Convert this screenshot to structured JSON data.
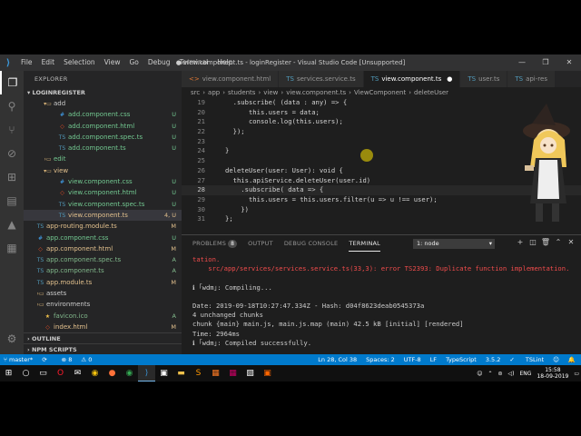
{
  "window": {
    "title": "● view.component.ts - loginRegister - Visual Studio Code [Unsupported]",
    "menu": [
      "File",
      "Edit",
      "Selection",
      "View",
      "Go",
      "Debug",
      "Terminal",
      "Help"
    ],
    "controls": [
      "—",
      "❐",
      "✕"
    ]
  },
  "sidebar": {
    "header": "EXPLORER",
    "project": "LOGINREGISTER",
    "items": [
      {
        "label": "add",
        "status": "",
        "kind": "folder-open",
        "indent": 22,
        "color": "c-plain"
      },
      {
        "label": "add.component.css",
        "status": "U",
        "kind": "css",
        "indent": 38,
        "color": "c-new"
      },
      {
        "label": "add.component.html",
        "status": "U",
        "kind": "html",
        "indent": 38,
        "color": "c-new"
      },
      {
        "label": "add.component.spec.ts",
        "status": "U",
        "kind": "ts",
        "indent": 38,
        "color": "c-new"
      },
      {
        "label": "add.component.ts",
        "status": "U",
        "kind": "ts",
        "indent": 38,
        "color": "c-new"
      },
      {
        "label": "edit",
        "status": "",
        "kind": "folder",
        "indent": 22,
        "color": "c-new"
      },
      {
        "label": "view",
        "status": "",
        "kind": "folder-open",
        "indent": 22,
        "color": "c-mod"
      },
      {
        "label": "view.component.css",
        "status": "U",
        "kind": "css",
        "indent": 38,
        "color": "c-new"
      },
      {
        "label": "view.component.html",
        "status": "U",
        "kind": "html",
        "indent": 38,
        "color": "c-new"
      },
      {
        "label": "view.component.spec.ts",
        "status": "U",
        "kind": "ts",
        "indent": 38,
        "color": "c-new"
      },
      {
        "label": "view.component.ts",
        "status": "4, U",
        "kind": "ts",
        "indent": 38,
        "color": "c-mod"
      },
      {
        "label": "app-routing.module.ts",
        "status": "M",
        "kind": "ts",
        "indent": 14,
        "color": "c-mod"
      },
      {
        "label": "app.component.css",
        "status": "U",
        "kind": "css",
        "indent": 14,
        "color": "c-new"
      },
      {
        "label": "app.component.html",
        "status": "M",
        "kind": "html",
        "indent": 14,
        "color": "c-mod"
      },
      {
        "label": "app.component.spec.ts",
        "status": "A",
        "kind": "ts",
        "indent": 14,
        "color": "c-added"
      },
      {
        "label": "app.component.ts",
        "status": "A",
        "kind": "ts",
        "indent": 14,
        "color": "c-added"
      },
      {
        "label": "app.module.ts",
        "status": "M",
        "kind": "ts",
        "indent": 14,
        "color": "c-mod"
      },
      {
        "label": "assets",
        "status": "",
        "kind": "folder",
        "indent": 14,
        "color": "c-plain"
      },
      {
        "label": "environments",
        "status": "",
        "kind": "folder",
        "indent": 14,
        "color": "c-plain"
      },
      {
        "label": "favicon.ico",
        "status": "A",
        "kind": "ico",
        "indent": 22,
        "color": "c-added"
      },
      {
        "label": "index.html",
        "status": "M",
        "kind": "html",
        "indent": 22,
        "color": "c-mod"
      }
    ],
    "outline": "OUTLINE",
    "npm": "NPM SCRIPTS"
  },
  "tabs": [
    {
      "label": "view.component.html",
      "icon": "<>",
      "active": false
    },
    {
      "label": "services.service.ts",
      "icon": "TS",
      "active": false
    },
    {
      "label": "view.component.ts",
      "icon": "TS",
      "active": true,
      "close": "●"
    },
    {
      "label": "user.ts",
      "icon": "TS",
      "active": false
    },
    {
      "label": "api-res",
      "icon": "TS",
      "active": false
    }
  ],
  "breadcrumb": [
    "src",
    "app",
    "students",
    "view",
    "view.component.ts",
    "ViewComponent",
    "deleteUser"
  ],
  "code": {
    "lines": [
      {
        "n": "19",
        "html": "  .subscribe( (data : any) => {"
      },
      {
        "n": "20",
        "html": "      this.users = data;"
      },
      {
        "n": "21",
        "html": "      console.log(this.users);"
      },
      {
        "n": "22",
        "html": "  });"
      },
      {
        "n": "23",
        "html": ""
      },
      {
        "n": "24",
        "html": "}"
      },
      {
        "n": "25",
        "html": ""
      },
      {
        "n": "26",
        "html": "deleteUser(user: User): void {"
      },
      {
        "n": "27",
        "html": "  this.apiService.deleteUser(user.id)"
      },
      {
        "n": "28",
        "html": "    .subscribe( data => {"
      },
      {
        "n": "29",
        "html": "      this.users = this.users.filter(u => u !== user);"
      },
      {
        "n": "30",
        "html": "    })"
      },
      {
        "n": "31",
        "html": "};"
      }
    ]
  },
  "panel": {
    "tabs": [
      "PROBLEMS",
      "OUTPUT",
      "DEBUG CONSOLE",
      "TERMINAL"
    ],
    "problems_count": "8",
    "terminal_select": "1: node",
    "terminal": [
      {
        "text": "tation.",
        "cls": "err"
      },
      {
        "text": "    src/app/services/services.service.ts(33,3): error TS2393: Duplicate function implementation.",
        "cls": "err"
      },
      {
        "text": "",
        "cls": ""
      },
      {
        "text": "ℹ ｢wdm｣: Compiling...",
        "cls": ""
      },
      {
        "text": "",
        "cls": ""
      },
      {
        "text": "Date: 2019-09-18T10:27:47.334Z - Hash: d04f8623deab0545373a",
        "cls": ""
      },
      {
        "text": "4 unchanged chunks",
        "cls": ""
      },
      {
        "text": "chunk {main} main.js, main.js.map (main) 42.5 kB [initial] [rendered]",
        "cls": ""
      },
      {
        "text": "Time: 2964ms",
        "cls": ""
      },
      {
        "text": "ℹ ｢wdm｣: Compiled successfully.",
        "cls": ""
      }
    ]
  },
  "status": {
    "branch": "master*",
    "sync": "⟳",
    "errors": "8",
    "warnings": "0",
    "position": "Ln 28, Col 38",
    "spaces": "Spaces: 2",
    "encoding": "UTF-8",
    "eol": "LF",
    "language": "TypeScript",
    "version": "3.5.2",
    "tslint": "TSLint"
  },
  "taskbar": {
    "time": "15:58",
    "date": "18-09-2019",
    "lang": "ENG"
  }
}
